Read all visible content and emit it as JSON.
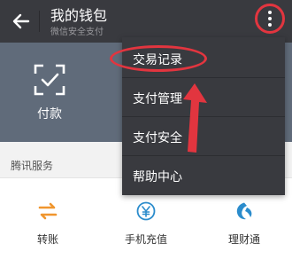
{
  "header": {
    "title": "我的钱包",
    "subtitle": "微信安全支付"
  },
  "pay_panel": {
    "label": "付款"
  },
  "section": {
    "title": "腾讯服务"
  },
  "services": [
    {
      "label": "转账",
      "icon": "transfer-icon",
      "color": "#f0962e"
    },
    {
      "label": "手机充值",
      "icon": "phone-recharge-icon",
      "color": "#2b8ccc"
    },
    {
      "label": "理财通",
      "icon": "wealth-icon",
      "color": "#2b8ccc"
    }
  ],
  "menu": {
    "items": [
      {
        "label": "交易记录"
      },
      {
        "label": "支付管理"
      },
      {
        "label": "支付安全"
      },
      {
        "label": "帮助中心"
      }
    ]
  },
  "colors": {
    "header_bg": "#393a3f",
    "panel_bg": "#606b7a",
    "highlight": "#e2353f"
  }
}
